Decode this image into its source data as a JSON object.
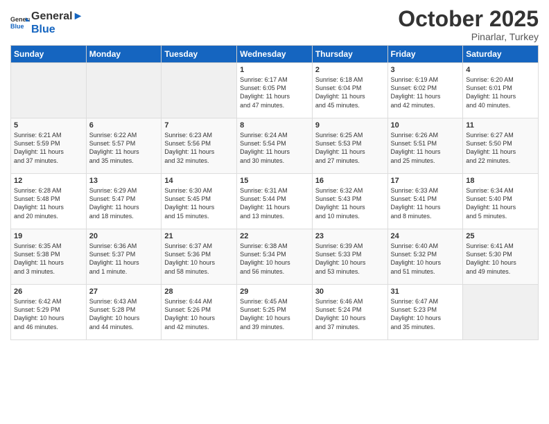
{
  "header": {
    "logo_general": "General",
    "logo_blue": "Blue",
    "month": "October 2025",
    "location": "Pinarlar, Turkey"
  },
  "weekdays": [
    "Sunday",
    "Monday",
    "Tuesday",
    "Wednesday",
    "Thursday",
    "Friday",
    "Saturday"
  ],
  "weeks": [
    [
      {
        "day": "",
        "info": ""
      },
      {
        "day": "",
        "info": ""
      },
      {
        "day": "",
        "info": ""
      },
      {
        "day": "1",
        "info": "Sunrise: 6:17 AM\nSunset: 6:05 PM\nDaylight: 11 hours\nand 47 minutes."
      },
      {
        "day": "2",
        "info": "Sunrise: 6:18 AM\nSunset: 6:04 PM\nDaylight: 11 hours\nand 45 minutes."
      },
      {
        "day": "3",
        "info": "Sunrise: 6:19 AM\nSunset: 6:02 PM\nDaylight: 11 hours\nand 42 minutes."
      },
      {
        "day": "4",
        "info": "Sunrise: 6:20 AM\nSunset: 6:01 PM\nDaylight: 11 hours\nand 40 minutes."
      }
    ],
    [
      {
        "day": "5",
        "info": "Sunrise: 6:21 AM\nSunset: 5:59 PM\nDaylight: 11 hours\nand 37 minutes."
      },
      {
        "day": "6",
        "info": "Sunrise: 6:22 AM\nSunset: 5:57 PM\nDaylight: 11 hours\nand 35 minutes."
      },
      {
        "day": "7",
        "info": "Sunrise: 6:23 AM\nSunset: 5:56 PM\nDaylight: 11 hours\nand 32 minutes."
      },
      {
        "day": "8",
        "info": "Sunrise: 6:24 AM\nSunset: 5:54 PM\nDaylight: 11 hours\nand 30 minutes."
      },
      {
        "day": "9",
        "info": "Sunrise: 6:25 AM\nSunset: 5:53 PM\nDaylight: 11 hours\nand 27 minutes."
      },
      {
        "day": "10",
        "info": "Sunrise: 6:26 AM\nSunset: 5:51 PM\nDaylight: 11 hours\nand 25 minutes."
      },
      {
        "day": "11",
        "info": "Sunrise: 6:27 AM\nSunset: 5:50 PM\nDaylight: 11 hours\nand 22 minutes."
      }
    ],
    [
      {
        "day": "12",
        "info": "Sunrise: 6:28 AM\nSunset: 5:48 PM\nDaylight: 11 hours\nand 20 minutes."
      },
      {
        "day": "13",
        "info": "Sunrise: 6:29 AM\nSunset: 5:47 PM\nDaylight: 11 hours\nand 18 minutes."
      },
      {
        "day": "14",
        "info": "Sunrise: 6:30 AM\nSunset: 5:45 PM\nDaylight: 11 hours\nand 15 minutes."
      },
      {
        "day": "15",
        "info": "Sunrise: 6:31 AM\nSunset: 5:44 PM\nDaylight: 11 hours\nand 13 minutes."
      },
      {
        "day": "16",
        "info": "Sunrise: 6:32 AM\nSunset: 5:43 PM\nDaylight: 11 hours\nand 10 minutes."
      },
      {
        "day": "17",
        "info": "Sunrise: 6:33 AM\nSunset: 5:41 PM\nDaylight: 11 hours\nand 8 minutes."
      },
      {
        "day": "18",
        "info": "Sunrise: 6:34 AM\nSunset: 5:40 PM\nDaylight: 11 hours\nand 5 minutes."
      }
    ],
    [
      {
        "day": "19",
        "info": "Sunrise: 6:35 AM\nSunset: 5:38 PM\nDaylight: 11 hours\nand 3 minutes."
      },
      {
        "day": "20",
        "info": "Sunrise: 6:36 AM\nSunset: 5:37 PM\nDaylight: 11 hours\nand 1 minute."
      },
      {
        "day": "21",
        "info": "Sunrise: 6:37 AM\nSunset: 5:36 PM\nDaylight: 10 hours\nand 58 minutes."
      },
      {
        "day": "22",
        "info": "Sunrise: 6:38 AM\nSunset: 5:34 PM\nDaylight: 10 hours\nand 56 minutes."
      },
      {
        "day": "23",
        "info": "Sunrise: 6:39 AM\nSunset: 5:33 PM\nDaylight: 10 hours\nand 53 minutes."
      },
      {
        "day": "24",
        "info": "Sunrise: 6:40 AM\nSunset: 5:32 PM\nDaylight: 10 hours\nand 51 minutes."
      },
      {
        "day": "25",
        "info": "Sunrise: 6:41 AM\nSunset: 5:30 PM\nDaylight: 10 hours\nand 49 minutes."
      }
    ],
    [
      {
        "day": "26",
        "info": "Sunrise: 6:42 AM\nSunset: 5:29 PM\nDaylight: 10 hours\nand 46 minutes."
      },
      {
        "day": "27",
        "info": "Sunrise: 6:43 AM\nSunset: 5:28 PM\nDaylight: 10 hours\nand 44 minutes."
      },
      {
        "day": "28",
        "info": "Sunrise: 6:44 AM\nSunset: 5:26 PM\nDaylight: 10 hours\nand 42 minutes."
      },
      {
        "day": "29",
        "info": "Sunrise: 6:45 AM\nSunset: 5:25 PM\nDaylight: 10 hours\nand 39 minutes."
      },
      {
        "day": "30",
        "info": "Sunrise: 6:46 AM\nSunset: 5:24 PM\nDaylight: 10 hours\nand 37 minutes."
      },
      {
        "day": "31",
        "info": "Sunrise: 6:47 AM\nSunset: 5:23 PM\nDaylight: 10 hours\nand 35 minutes."
      },
      {
        "day": "",
        "info": ""
      }
    ]
  ]
}
